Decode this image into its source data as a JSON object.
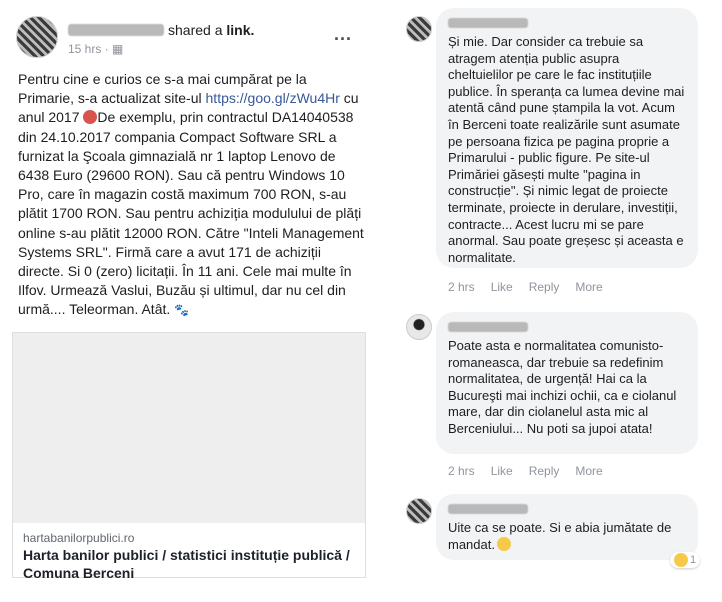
{
  "post": {
    "shared_text": "shared a",
    "shared_link": "link.",
    "time": "15 hrs ·",
    "more": "...",
    "text_part1": "Pentru cine e curios ce s-a mai cumpărat pe la Primarie, s-a actualizat site-ul ",
    "url": "https://goo.gl/zWu4Hr",
    "text_part2": " cu anul 2017",
    "text_part3": "De exemplu, prin contractul DA14040538 din 24.10.2017 compania Compact Software SRL a furnizat la Şcoala gimnazială nr 1 laptop Lenovo de 6438 Euro (29600 RON). Sau că pentru Windows 10 Pro, care în magazin costă maximum 700 RON, s-au plătit 1700 RON. Sau pentru achiziția modulului de plăți online s-au plătit 12000 RON. Către \"Inteli Management Systems SRL\". Firmă care a avut 171 de achiziții directe. Si 0 (zero) licitații. În 11 ani. Cele mai multe în Ilfov. Urmează Vaslui, Buzău și ultimul, dar nu cel din urmă.... Teleorman. Atât.",
    "paw": "🐾",
    "link_domain": "hartabanilorpublici.ro",
    "link_title": "Harta banilor publici / statistici instituție publică / Comuna Berceni"
  },
  "comments": [
    {
      "text": "Și mie. Dar consider ca trebuie sa atragem atenția public asupra cheltuielilor pe care le fac instituțiile publice. În speranța ca lumea devine mai atentă când pune ștampila la vot. Acum în Berceni toate realizările sunt asumate pe persoana fizica pe pagina proprie a Primarului - public figure. Pe site-ul Primăriei găsești multe \"pagina in construcție\". Și nimic legat de proiecte terminate, proiecte in derulare, investiții, contracte... Acest lucru mi se pare anormal. Sau poate greșesc și aceasta e normalitate.",
      "time": "2 hrs",
      "like": "Like",
      "reply": "Reply",
      "more": "More"
    },
    {
      "text": "Poate asta e normalitatea comunisto-romaneasca, dar trebuie sa redefinim normalitatea, de urgență! Hai ca la Bucureşti mai inchizi ochii, ca e ciolanul mare, dar din ciolanelul asta mic al Berceniului... Nu poti sa jupoi atata!",
      "time": "2 hrs",
      "like": "Like",
      "reply": "Reply",
      "more": "More"
    },
    {
      "text": "Uite ca se poate. Si e abia jumătate de mandat.",
      "reaction_count": "1"
    }
  ]
}
